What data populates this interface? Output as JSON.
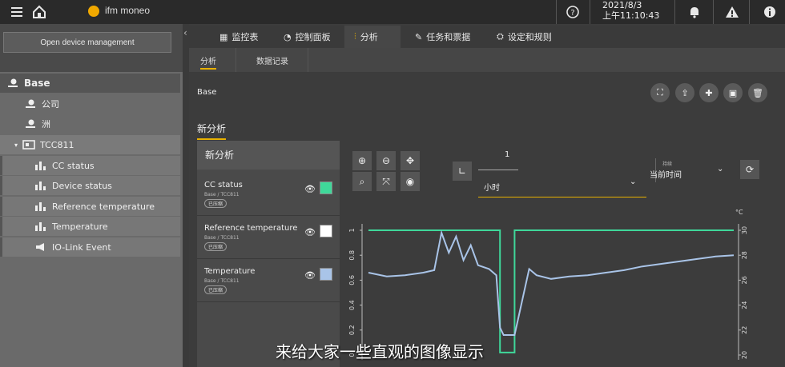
{
  "topbar": {
    "logo_text": "ifm moneo",
    "date": "2021/8/3",
    "time": "上午11:10:43"
  },
  "sidebar": {
    "open_button": "Open device management",
    "base": "Base",
    "items": [
      {
        "label": "公司",
        "icon": "location-icon"
      },
      {
        "label": "洲",
        "icon": "location-icon"
      }
    ],
    "device": "TCC811",
    "signals": [
      {
        "label": "CC status",
        "icon": "chart-bar-icon"
      },
      {
        "label": "Device status",
        "icon": "chart-bar-icon"
      },
      {
        "label": "Reference temperature",
        "icon": "chart-bar-icon"
      },
      {
        "label": "Temperature",
        "icon": "chart-bar-icon"
      },
      {
        "label": "IO-Link Event",
        "icon": "megaphone-icon"
      }
    ]
  },
  "tabs": [
    {
      "label": "监控表",
      "icon": "table-icon"
    },
    {
      "label": "控制面板",
      "icon": "dashboard-icon"
    },
    {
      "label": "分析",
      "icon": "analysis-icon"
    },
    {
      "label": "任务和票据",
      "icon": "task-icon"
    },
    {
      "label": "设定和规则",
      "icon": "rules-icon"
    }
  ],
  "subtabs": [
    "分析",
    "数据记录"
  ],
  "main": {
    "base_label": "Base",
    "new_analysis_title": "新分析"
  },
  "signal_panel": {
    "title": "新分析",
    "signals": [
      {
        "name": "CC status",
        "path": "Base / TCC811",
        "badge": "已压缩",
        "color": "#3fd89a"
      },
      {
        "name": "Reference temperature",
        "path": "Base / TCC811",
        "badge": "已压缩",
        "color": "#ffffff"
      },
      {
        "name": "Temperature",
        "path": "Base / TCC811",
        "badge": "已压缩",
        "color": "#a9c4e8"
      }
    ]
  },
  "time_control": {
    "number": "1",
    "unit": "小时",
    "range_label": "持续",
    "range_value": "当前时间"
  },
  "subtitle": "来给大家一些直观的图像显示",
  "chart_data": {
    "type": "line",
    "left_axis": {
      "ticks": [
        "0",
        "0.2",
        "0.4",
        "0.6",
        "0.8",
        "1"
      ],
      "ylim": [
        0,
        1
      ]
    },
    "right_axis": {
      "unit": "°C",
      "ticks": [
        "20",
        "22",
        "24",
        "26",
        "28",
        "30"
      ],
      "ylim": [
        20,
        30
      ]
    },
    "series": [
      {
        "color": "#3fd89a",
        "axis": "left",
        "x": [
          0,
          0.18,
          0.18,
          0.36,
          0.36,
          0.4,
          0.4,
          0.44,
          0.44,
          1
        ],
        "y": [
          1,
          1,
          1,
          1,
          0.02,
          0.02,
          1,
          1,
          1,
          1
        ]
      },
      {
        "color": "#a9c4e8",
        "axis": "right",
        "x": [
          0,
          0.05,
          0.1,
          0.15,
          0.18,
          0.2,
          0.22,
          0.24,
          0.26,
          0.28,
          0.3,
          0.33,
          0.35,
          0.36,
          0.37,
          0.4,
          0.44,
          0.46,
          0.5,
          0.55,
          0.6,
          0.65,
          0.7,
          0.75,
          0.8,
          0.85,
          0.9,
          0.95,
          1.0
        ],
        "y": [
          26.6,
          26.3,
          26.4,
          26.6,
          26.8,
          29.8,
          28.2,
          29.5,
          27.6,
          28.8,
          27.2,
          26.9,
          26.4,
          22.2,
          21.6,
          21.6,
          26.9,
          26.4,
          26.1,
          26.3,
          26.4,
          26.6,
          26.8,
          27.1,
          27.3,
          27.5,
          27.7,
          27.9,
          28.0
        ]
      }
    ]
  }
}
